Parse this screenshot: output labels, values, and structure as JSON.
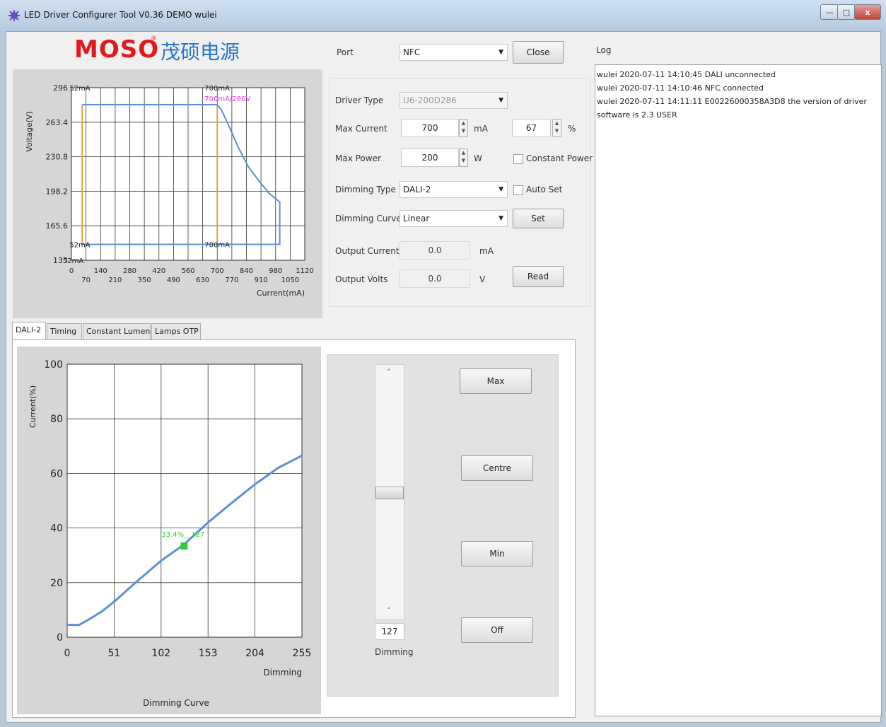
{
  "window": {
    "title": "LED Driver Configurer Tool V0.36 DEMO  wulei",
    "btn_min": "—",
    "btn_max": "□",
    "btn_close": "x"
  },
  "brand": {
    "logo_text": "MOSO",
    "chinese_name": "茂硕电源",
    "registered_mark": "®"
  },
  "controls": {
    "port_label": "Port",
    "port_value": "NFC",
    "close_button": "Close",
    "driver_type_label": "Driver Type",
    "driver_type_value": "U6-200D286",
    "max_current_label": "Max Current",
    "max_current_value": "700",
    "max_current_unit": "mA",
    "percent_value": "67",
    "percent_unit": "%",
    "max_power_label": "Max Power",
    "max_power_value": "200",
    "max_power_unit": "W",
    "constant_power_label": "Constant Power",
    "dimming_type_label": "Dimming Type",
    "dimming_type_value": "DALI-2",
    "auto_set_label": "Auto Set",
    "dimming_curve_label": "Dimming Curve",
    "dimming_curve_value": "Linear",
    "set_button": "Set",
    "output_current_label": "Output Current",
    "output_current_value": "0.0",
    "output_current_unit": "mA",
    "output_volts_label": "Output Volts",
    "output_volts_value": "0.0",
    "output_volts_unit": "V",
    "read_button": "Read"
  },
  "tabs": [
    {
      "label": "DALI-2",
      "active": true
    },
    {
      "label": "Timing"
    },
    {
      "label": "Constant Lumen"
    },
    {
      "label": "Lamps OTP"
    }
  ],
  "dimming_panel": {
    "max_button": "Max",
    "centre_button": "Centre",
    "min_button": "Min",
    "off_button": "Off",
    "slider_value": "127",
    "slider_label": "Dimming",
    "slider_level": 0.5,
    "up_arrow": "˄",
    "down_arrow": "˅"
  },
  "log": {
    "label": "Log",
    "entries": [
      "wulei 2020-07-11 14:10:45 DALI unconnected",
      "wulei 2020-07-11 14:10:46 NFC connected",
      "wulei 2020-07-11 14:11:11 E00226000358A3D8 the version of driver software is  2.3 USER"
    ]
  },
  "chart_data": [
    {
      "type": "line",
      "ylabel": "Voltage(V)",
      "xlabel": "Current(mA)",
      "xlim": [
        0,
        1120
      ],
      "ylim": [
        133,
        296
      ],
      "x_ticks": [
        "0",
        "140",
        "280",
        "420",
        "560",
        "700",
        "840",
        "980",
        "1120"
      ],
      "x_ticks_minor": [
        "70",
        "210",
        "350",
        "490",
        "630",
        "770",
        "910",
        "1050"
      ],
      "y_ticks": [
        "296",
        "263.4",
        "230.8",
        "198.2",
        "165.6",
        "133"
      ],
      "series": [
        {
          "color": "#e2a33c",
          "points": [
            [
              52,
              280
            ],
            [
              700,
              280
            ],
            [
              700,
              148
            ],
            [
              52,
              148
            ],
            [
              52,
              280
            ]
          ]
        },
        {
          "color": "#5b8fd8",
          "points": [
            [
              52,
              280
            ],
            [
              700,
              280
            ],
            [
              720,
              275
            ],
            [
              760,
              258
            ],
            [
              800,
              240
            ],
            [
              850,
              221
            ],
            [
              900,
              208
            ],
            [
              950,
              196
            ],
            [
              1000,
              188
            ],
            [
              1000,
              148
            ],
            [
              52,
              148
            ]
          ]
        }
      ],
      "annotations": [
        {
          "text": "52mA",
          "x": 52,
          "y": 296
        },
        {
          "text": "700mA",
          "x": 700,
          "y": 296
        },
        {
          "text": "700mA/286V",
          "x": 700,
          "y": 286,
          "color": "#e03ce0"
        },
        {
          "text": "52mA",
          "x": 52,
          "y": 148
        },
        {
          "text": "700mA",
          "x": 700,
          "y": 148
        },
        {
          "text": "52mA",
          "x": 20,
          "y": 133
        }
      ]
    },
    {
      "type": "line",
      "title": "Dimming Curve",
      "ylabel": "Current(%)",
      "xlabel": "Dimming",
      "xlim": [
        0,
        255
      ],
      "ylim": [
        0,
        100
      ],
      "x_ticks": [
        "0",
        "51",
        "102",
        "153",
        "204",
        "255"
      ],
      "y_ticks": [
        "0",
        "20",
        "40",
        "60",
        "80",
        "100"
      ],
      "series": [
        {
          "color": "#5b8fd8",
          "points": [
            [
              0,
              4.5
            ],
            [
              13,
              4.5
            ],
            [
              25,
              6.8
            ],
            [
              38,
              9.5
            ],
            [
              51,
              13
            ],
            [
              76,
              20.5
            ],
            [
              102,
              28
            ],
            [
              127,
              34
            ],
            [
              153,
              42
            ],
            [
              178,
              49
            ],
            [
              204,
              56
            ],
            [
              229,
              62
            ],
            [
              255,
              66.5
            ]
          ]
        }
      ],
      "marker": {
        "x": 127,
        "y": 33.4,
        "label": "33.4%__127",
        "color": "#32cd32"
      }
    }
  ]
}
